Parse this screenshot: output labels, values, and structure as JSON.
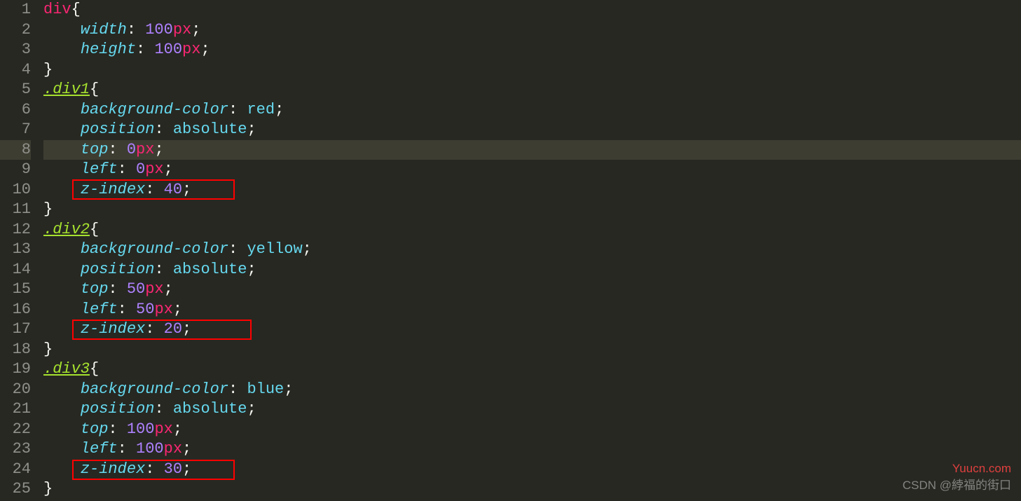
{
  "lineCount": 25,
  "currentLine": 8,
  "code": {
    "lines": [
      {
        "n": 1,
        "tokens": [
          {
            "t": "tag",
            "v": "div"
          },
          {
            "t": "punct",
            "v": "{"
          }
        ]
      },
      {
        "n": 2,
        "tokens": [
          {
            "t": "indent",
            "v": "    "
          },
          {
            "t": "prop",
            "v": "width"
          },
          {
            "t": "colon",
            "v": ": "
          },
          {
            "t": "num",
            "v": "100"
          },
          {
            "t": "unit",
            "v": "px"
          },
          {
            "t": "semi",
            "v": ";"
          }
        ]
      },
      {
        "n": 3,
        "tokens": [
          {
            "t": "indent",
            "v": "    "
          },
          {
            "t": "prop",
            "v": "height"
          },
          {
            "t": "colon",
            "v": ": "
          },
          {
            "t": "num",
            "v": "100"
          },
          {
            "t": "unit",
            "v": "px"
          },
          {
            "t": "semi",
            "v": ";"
          }
        ]
      },
      {
        "n": 4,
        "tokens": [
          {
            "t": "punct",
            "v": "}"
          }
        ]
      },
      {
        "n": 5,
        "tokens": [
          {
            "t": "selector",
            "v": ".div1",
            "u": true
          },
          {
            "t": "punct",
            "v": "{"
          }
        ]
      },
      {
        "n": 6,
        "tokens": [
          {
            "t": "indent",
            "v": "    "
          },
          {
            "t": "prop",
            "v": "background-color"
          },
          {
            "t": "colon",
            "v": ": "
          },
          {
            "t": "val",
            "v": "red"
          },
          {
            "t": "semi",
            "v": ";"
          }
        ]
      },
      {
        "n": 7,
        "tokens": [
          {
            "t": "indent",
            "v": "    "
          },
          {
            "t": "prop",
            "v": "position"
          },
          {
            "t": "colon",
            "v": ": "
          },
          {
            "t": "val",
            "v": "absolute"
          },
          {
            "t": "semi",
            "v": ";"
          }
        ]
      },
      {
        "n": 8,
        "tokens": [
          {
            "t": "indent",
            "v": "    "
          },
          {
            "t": "prop",
            "v": "top"
          },
          {
            "t": "colon",
            "v": ": "
          },
          {
            "t": "num",
            "v": "0"
          },
          {
            "t": "unit",
            "v": "px"
          },
          {
            "t": "semi",
            "v": ";"
          }
        ],
        "hl": true
      },
      {
        "n": 9,
        "tokens": [
          {
            "t": "indent",
            "v": "    "
          },
          {
            "t": "prop",
            "v": "left"
          },
          {
            "t": "colon",
            "v": ": "
          },
          {
            "t": "num",
            "v": "0"
          },
          {
            "t": "unit",
            "v": "px"
          },
          {
            "t": "semi",
            "v": ";"
          }
        ]
      },
      {
        "n": 10,
        "tokens": [
          {
            "t": "indent",
            "v": "    "
          },
          {
            "t": "prop",
            "v": "z-index"
          },
          {
            "t": "colon",
            "v": ": "
          },
          {
            "t": "num",
            "v": "40"
          },
          {
            "t": "semi",
            "v": ";"
          }
        ]
      },
      {
        "n": 11,
        "tokens": [
          {
            "t": "punct",
            "v": "}"
          }
        ]
      },
      {
        "n": 12,
        "tokens": [
          {
            "t": "selector",
            "v": ".div2",
            "u": true
          },
          {
            "t": "punct",
            "v": "{"
          }
        ]
      },
      {
        "n": 13,
        "tokens": [
          {
            "t": "indent",
            "v": "    "
          },
          {
            "t": "prop",
            "v": "background-color"
          },
          {
            "t": "colon",
            "v": ": "
          },
          {
            "t": "val",
            "v": "yellow"
          },
          {
            "t": "semi",
            "v": ";"
          }
        ]
      },
      {
        "n": 14,
        "tokens": [
          {
            "t": "indent",
            "v": "    "
          },
          {
            "t": "prop",
            "v": "position"
          },
          {
            "t": "colon",
            "v": ": "
          },
          {
            "t": "val",
            "v": "absolute"
          },
          {
            "t": "semi",
            "v": ";"
          }
        ]
      },
      {
        "n": 15,
        "tokens": [
          {
            "t": "indent",
            "v": "    "
          },
          {
            "t": "prop",
            "v": "top"
          },
          {
            "t": "colon",
            "v": ": "
          },
          {
            "t": "num",
            "v": "50"
          },
          {
            "t": "unit",
            "v": "px"
          },
          {
            "t": "semi",
            "v": ";"
          }
        ]
      },
      {
        "n": 16,
        "tokens": [
          {
            "t": "indent",
            "v": "    "
          },
          {
            "t": "prop",
            "v": "left"
          },
          {
            "t": "colon",
            "v": ": "
          },
          {
            "t": "num",
            "v": "50"
          },
          {
            "t": "unit",
            "v": "px"
          },
          {
            "t": "semi",
            "v": ";"
          }
        ]
      },
      {
        "n": 17,
        "tokens": [
          {
            "t": "indent",
            "v": "    "
          },
          {
            "t": "prop",
            "v": "z-index"
          },
          {
            "t": "colon",
            "v": ": "
          },
          {
            "t": "num",
            "v": "20"
          },
          {
            "t": "semi",
            "v": ";"
          }
        ]
      },
      {
        "n": 18,
        "tokens": [
          {
            "t": "punct",
            "v": "}"
          }
        ]
      },
      {
        "n": 19,
        "tokens": [
          {
            "t": "selector",
            "v": ".div3",
            "u": true
          },
          {
            "t": "punct",
            "v": "{"
          }
        ]
      },
      {
        "n": 20,
        "tokens": [
          {
            "t": "indent",
            "v": "    "
          },
          {
            "t": "prop",
            "v": "background-color"
          },
          {
            "t": "colon",
            "v": ": "
          },
          {
            "t": "val",
            "v": "blue"
          },
          {
            "t": "semi",
            "v": ";"
          }
        ]
      },
      {
        "n": 21,
        "tokens": [
          {
            "t": "indent",
            "v": "    "
          },
          {
            "t": "prop",
            "v": "position"
          },
          {
            "t": "colon",
            "v": ": "
          },
          {
            "t": "val",
            "v": "absolute"
          },
          {
            "t": "semi",
            "v": ";"
          }
        ]
      },
      {
        "n": 22,
        "tokens": [
          {
            "t": "indent",
            "v": "    "
          },
          {
            "t": "prop",
            "v": "top"
          },
          {
            "t": "colon",
            "v": ": "
          },
          {
            "t": "num",
            "v": "100"
          },
          {
            "t": "unit",
            "v": "px"
          },
          {
            "t": "semi",
            "v": ";"
          }
        ]
      },
      {
        "n": 23,
        "tokens": [
          {
            "t": "indent",
            "v": "    "
          },
          {
            "t": "prop",
            "v": "left"
          },
          {
            "t": "colon",
            "v": ": "
          },
          {
            "t": "num",
            "v": "100"
          },
          {
            "t": "unit",
            "v": "px"
          },
          {
            "t": "semi",
            "v": ";"
          }
        ]
      },
      {
        "n": 24,
        "tokens": [
          {
            "t": "indent",
            "v": "    "
          },
          {
            "t": "prop",
            "v": "z-index"
          },
          {
            "t": "colon",
            "v": ": "
          },
          {
            "t": "num",
            "v": "30"
          },
          {
            "t": "semi",
            "v": ";"
          }
        ]
      },
      {
        "n": 25,
        "tokens": [
          {
            "t": "punct",
            "v": "}"
          }
        ]
      }
    ]
  },
  "watermarks": {
    "site": "Yuucn.com",
    "author": "CSDN @綍福的街口"
  }
}
